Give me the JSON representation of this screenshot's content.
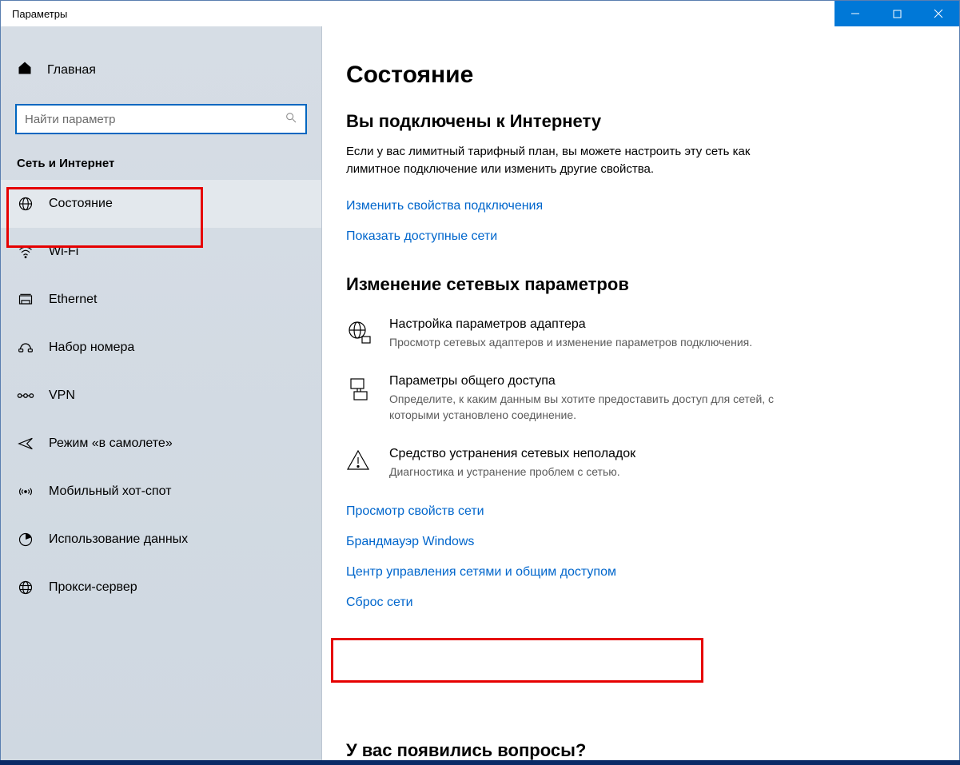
{
  "window": {
    "title": "Параметры"
  },
  "sidebar": {
    "home": "Главная",
    "search": {
      "placeholder": "Найти параметр"
    },
    "section": "Сеть и Интернет",
    "items": [
      {
        "id": "status",
        "label": "Состояние",
        "selected": true
      },
      {
        "id": "wifi",
        "label": "Wi-Fi",
        "selected": false
      },
      {
        "id": "ethernet",
        "label": "Ethernet",
        "selected": false
      },
      {
        "id": "dialup",
        "label": "Набор номера",
        "selected": false
      },
      {
        "id": "vpn",
        "label": "VPN",
        "selected": false
      },
      {
        "id": "airplane",
        "label": "Режим «в самолете»",
        "selected": false
      },
      {
        "id": "hotspot",
        "label": "Мобильный хот-спот",
        "selected": false
      },
      {
        "id": "datausage",
        "label": "Использование данных",
        "selected": false
      },
      {
        "id": "proxy",
        "label": "Прокси-сервер",
        "selected": false
      }
    ]
  },
  "main": {
    "title": "Состояние",
    "connected_heading": "Вы подключены к Интернету",
    "connected_desc": "Если у вас лимитный тарифный план, вы можете настроить эту сеть как лимитное подключение или изменить другие свойства.",
    "link_change_props": "Изменить свойства подключения",
    "link_show_networks": "Показать доступные сети",
    "change_settings_heading": "Изменение сетевых параметров",
    "blocks": [
      {
        "title": "Настройка параметров адаптера",
        "desc": "Просмотр сетевых адаптеров и изменение параметров подключения."
      },
      {
        "title": "Параметры общего доступа",
        "desc": "Определите, к каким данным вы хотите предоставить доступ для сетей, с которыми установлено соединение."
      },
      {
        "title": "Средство устранения сетевых неполадок",
        "desc": "Диагностика и устранение проблем с сетью."
      }
    ],
    "link_view_props": "Просмотр свойств сети",
    "link_firewall": "Брандмауэр Windows",
    "link_network_center": "Центр управления сетями и общим доступом",
    "link_reset": "Сброс сети",
    "bottom_heading": "У вас появились вопросы?"
  }
}
